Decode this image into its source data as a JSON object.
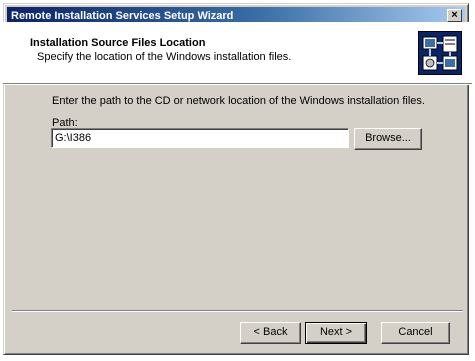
{
  "window": {
    "title": "Remote Installation Services Setup Wizard",
    "close_label": "×"
  },
  "header": {
    "title": "Installation Source Files Location",
    "subtitle": "Specify the location of the Windows installation files.",
    "icon": "wizard-network-icon"
  },
  "main": {
    "instruction": "Enter the path to the CD or network location of the Windows installation files.",
    "path_label": "Path:",
    "path_value": "G:\\I386",
    "browse_label": "Browse..."
  },
  "footer": {
    "back_label": "< Back",
    "next_label": "Next >",
    "cancel_label": "Cancel"
  },
  "colors": {
    "titlebar_start": "#0a246a",
    "titlebar_end": "#a6caf0",
    "dialog_face": "#d4d0c8"
  }
}
